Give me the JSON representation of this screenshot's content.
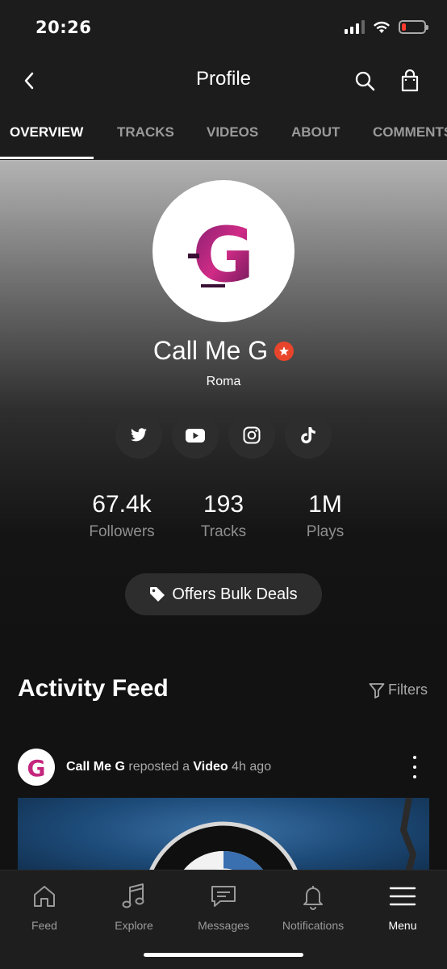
{
  "status_bar": {
    "time": "20:26"
  },
  "header": {
    "title": "Profile"
  },
  "tabs": [
    {
      "label": "OVERVIEW",
      "active": true
    },
    {
      "label": "TRACKS"
    },
    {
      "label": "VIDEOS"
    },
    {
      "label": "ABOUT"
    },
    {
      "label": "COMMENTS"
    }
  ],
  "profile": {
    "name": "Call Me G",
    "location": "Roma",
    "avatar_letter": "G",
    "socials": [
      "twitter-icon",
      "youtube-icon",
      "instagram-icon",
      "tiktok-icon"
    ],
    "stats": [
      {
        "value": "67.4k",
        "label": "Followers"
      },
      {
        "value": "193",
        "label": "Tracks"
      },
      {
        "value": "1M",
        "label": "Plays"
      }
    ],
    "bulk_deals_label": "Offers Bulk Deals"
  },
  "feed": {
    "title": "Activity Feed",
    "filters_label": "Filters",
    "post": {
      "user": "Call Me G",
      "action": "reposted a",
      "object": "Video",
      "time": "4h ago"
    }
  },
  "bottom_nav": [
    {
      "label": "Feed",
      "icon": "home-icon"
    },
    {
      "label": "Explore",
      "icon": "music-note-icon"
    },
    {
      "label": "Messages",
      "icon": "message-icon"
    },
    {
      "label": "Notifications",
      "icon": "bell-icon"
    },
    {
      "label": "Menu",
      "icon": "menu-icon",
      "active": true
    }
  ],
  "colors": {
    "background": "#141414",
    "verified_badge": "#e8452c",
    "avatar_logo": "#c4267e",
    "battery_low": "#ff3b30"
  }
}
